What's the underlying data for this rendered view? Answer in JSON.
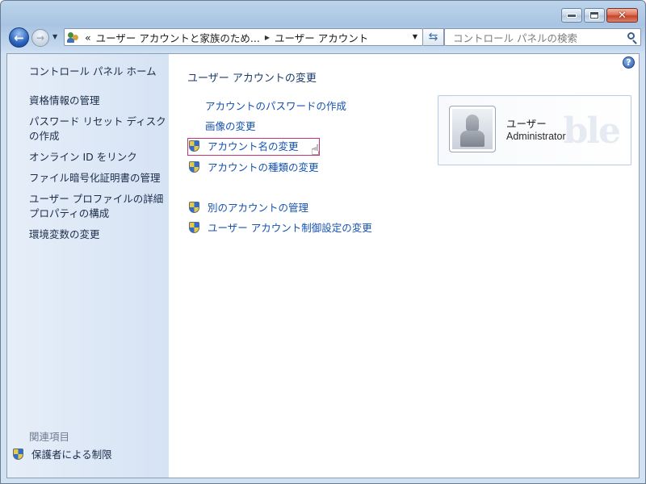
{
  "window": {
    "minimize": "minimize",
    "maximize": "maximize",
    "close": "close"
  },
  "nav": {
    "address_prefix": "«",
    "breadcrumb": [
      "ユーザー アカウントと家族のため...",
      "ユーザー アカウント"
    ],
    "search_placeholder": "コントロール パネルの検索"
  },
  "sidebar": {
    "home": "コントロール パネル ホーム",
    "items": [
      "資格情報の管理",
      "パスワード リセット ディスクの作成",
      "オンライン ID をリンク",
      "ファイル暗号化証明書の管理",
      "ユーザー プロファイルの詳細プロパティの構成",
      "環境変数の変更"
    ],
    "item_lines": [
      [
        "資格情報の管理"
      ],
      [
        "パスワード リセット ディスク",
        "の作成"
      ],
      [
        "オンライン ID をリンク"
      ],
      [
        "ファイル暗号化証明書の管理"
      ],
      [
        "ユーザー プロファイルの詳細",
        "プロパティの構成"
      ],
      [
        "環境変数の変更"
      ]
    ],
    "related_heading": "関連項目",
    "related_items": [
      "保護者による制限"
    ]
  },
  "main": {
    "heading": "ユーザー アカウントの変更",
    "tasks": [
      {
        "label": "アカウントのパスワードの作成",
        "shield": false
      },
      {
        "label": "画像の変更",
        "shield": false
      },
      {
        "label": "アカウント名の変更",
        "shield": true,
        "highlighted": true
      },
      {
        "label": "アカウントの種類の変更",
        "shield": true
      }
    ],
    "other_tasks": [
      {
        "label": "別のアカウントの管理",
        "shield": true
      },
      {
        "label": "ユーザー アカウント制御設定の変更",
        "shield": true
      }
    ]
  },
  "user_card": {
    "name": "ユーザー",
    "role": "Administrator",
    "watermark": "ble"
  },
  "icons": {
    "help": "help-icon",
    "shield": "uac-shield-icon",
    "search": "search-icon",
    "back": "back-arrow-icon",
    "forward": "forward-arrow-icon",
    "refresh": "refresh-icon",
    "pointer": "hand-pointer-icon"
  },
  "colors": {
    "link": "#1552b0",
    "sidebar_text": "#1b2c4a",
    "highlight_border": "#c8327a"
  }
}
